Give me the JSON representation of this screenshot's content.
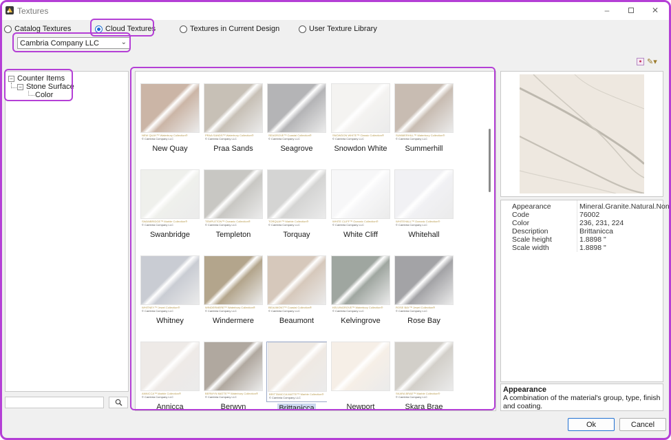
{
  "window": {
    "title": "Textures"
  },
  "source_options": [
    {
      "label": "Catalog Textures",
      "checked": false
    },
    {
      "label": "Cloud Textures",
      "checked": true
    },
    {
      "label": "Textures in Current Design",
      "checked": false
    },
    {
      "label": "User Texture Library",
      "checked": false
    }
  ],
  "company": {
    "selected": "Cambria Company LLC"
  },
  "tree": {
    "root": "Counter Items",
    "child": "Stone Surface",
    "leaf": "Color"
  },
  "textures": [
    {
      "name": "New Quay",
      "caption": "NEW QUAY™ Waterbury Collection®",
      "maker": "© Cambria Company LLC",
      "color": "#cbb5a6"
    },
    {
      "name": "Praa Sands",
      "caption": "PRAA SANDS™ Waterbury Collection®",
      "maker": "© Cambria Company LLC",
      "color": "#c7c0b6"
    },
    {
      "name": "Seagrove",
      "caption": "SEAGROVE™ Coastal Collection®",
      "maker": "© Cambria Company LLC",
      "color": "#b4b4b6"
    },
    {
      "name": "Snowdon White",
      "caption": "SNOWDON WHITE™ Classic Collection®",
      "maker": "© Cambria Company LLC",
      "color": "#f4f3f1"
    },
    {
      "name": "Summerhill",
      "caption": "SUMMERHILL™ Waterbury Collection®",
      "maker": "© Cambria Company LLC",
      "color": "#c8bcb2"
    },
    {
      "name": "Swanbridge",
      "caption": "SWANBRIDGE™ Marble Collection®",
      "maker": "© Cambria Company LLC",
      "color": "#eff0ec"
    },
    {
      "name": "Templeton",
      "caption": "TEMPLETON™ Oceanic Collection®",
      "maker": "© Cambria Company LLC",
      "color": "#c8c7c3"
    },
    {
      "name": "Torquay",
      "caption": "TORQUAY™ Marble Collection®",
      "maker": "© Cambria Company LLC",
      "color": "#d4d4d3"
    },
    {
      "name": "White Cliff",
      "caption": "WHITE CLIFF™ Oceanic Collection®",
      "maker": "© Cambria Company LLC",
      "color": "#f7f7f8"
    },
    {
      "name": "Whitehall",
      "caption": "WHITEHALL™ Oceanic Collection®",
      "maker": "© Cambria Company LLC",
      "color": "#f1f1f4"
    },
    {
      "name": "Whitney",
      "caption": "WHITNEY™ Jewel Collection®",
      "maker": "© Cambria Company LLC",
      "color": "#c9ccd3"
    },
    {
      "name": "Windermere",
      "caption": "WINDERMERE™ Waterbury Collection®",
      "maker": "© Cambria Company LLC",
      "color": "#b3a58c"
    },
    {
      "name": "Beaumont",
      "caption": "BEAUMONT™ Coastal Collection®",
      "maker": "© Cambria Company LLC",
      "color": "#d6c8bb"
    },
    {
      "name": "Kelvingrove",
      "caption": "KELVINGROVE™ Waterbury Collection®",
      "maker": "© Cambria Company LLC",
      "color": "#9fa6a0"
    },
    {
      "name": "Rose Bay",
      "caption": "ROSE BAY™ Jewel Collection®",
      "maker": "© Cambria Company LLC",
      "color": "#a3a3a6"
    },
    {
      "name": "Annicca",
      "caption": "ANNICCA™ Marble Collection®",
      "maker": "© Cambria Company LLC",
      "color": "#eeeae7"
    },
    {
      "name": "Berwyn",
      "caption": "BERWYN MATTE™ Waterbury Collection®",
      "maker": "© Cambria Company LLC",
      "color": "#b0a89f"
    },
    {
      "name": "Brittanicca",
      "caption": "BRITTANICCA MATTE™ Marble Collection®",
      "maker": "© Cambria Company LLC",
      "color": "#efe9e3"
    },
    {
      "name": "Newport",
      "caption": "",
      "maker": "",
      "color": "#f6efe7"
    },
    {
      "name": "Skara Brae",
      "caption": "SKARA BRAE™ Marble Collection®",
      "maker": "© Cambria Company LLC",
      "color": "#d2cfc9"
    }
  ],
  "properties": [
    {
      "key": "Appearance",
      "value": "Mineral.Granite.Natural.None"
    },
    {
      "key": "Code",
      "value": "76002"
    },
    {
      "key": "Color",
      "value": "236, 231, 224"
    },
    {
      "key": "Description",
      "value": "Brittanicca"
    },
    {
      "key": "Scale height",
      "value": "1.8898 \""
    },
    {
      "key": "Scale width",
      "value": "1.8898 \""
    }
  ],
  "description": {
    "title": "Appearance",
    "text": "A combination of the material's group, type, finish and coating."
  },
  "buttons": {
    "ok": "Ok",
    "cancel": "Cancel"
  },
  "icons": {
    "app": "texture-app-icon",
    "minimize": "minimize-icon",
    "maximize": "maximize-icon",
    "close": "close-icon",
    "search": "search-icon",
    "tool1": "texture-add-icon",
    "tool2": "ruler-dropdown-icon"
  }
}
